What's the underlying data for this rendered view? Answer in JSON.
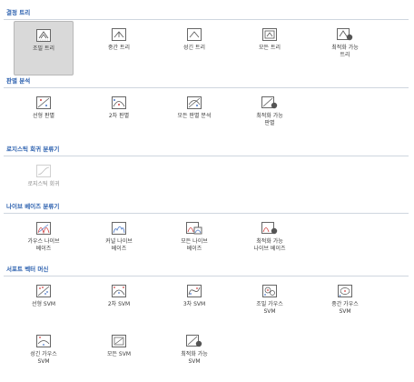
{
  "sections": {
    "decision_trees": {
      "title": "결정 트리",
      "items": [
        "조밀 트리",
        "중간 트리",
        "성긴 트리",
        "모든 트리",
        "최적화 가능\n트리"
      ]
    },
    "discriminant": {
      "title": "판별 분석",
      "items": [
        "선형 판별",
        "2차 판별",
        "모든 판별 분석",
        "최적화 가능\n판별"
      ]
    },
    "logistic": {
      "title": "로지스틱 회귀 분류기",
      "items": [
        "로지스틱 회귀"
      ]
    },
    "naive_bayes": {
      "title": "나이브 베이즈 분류기",
      "items": [
        "가우스 나이브\n베이즈",
        "커널 나이브\n베이즈",
        "모든 나이브\n베이즈",
        "최적화 가능\n나이브 베이즈"
      ]
    },
    "svm": {
      "title": "서포트 벡터 머신",
      "items": [
        "선형 SVM",
        "2차 SVM",
        "3차 SVM",
        "조밀 가우스\nSVM",
        "중간 가우스\nSVM",
        "성긴 가우스\nSVM",
        "모든 SVM",
        "최적화 가능\nSVM"
      ]
    }
  },
  "colors": {
    "header_text": "#2a5fae",
    "selected_bg": "#d9d9d9",
    "icon_stroke": "#555555",
    "icon_accent_red": "#d04040",
    "icon_accent_blue": "#4a78c8"
  }
}
